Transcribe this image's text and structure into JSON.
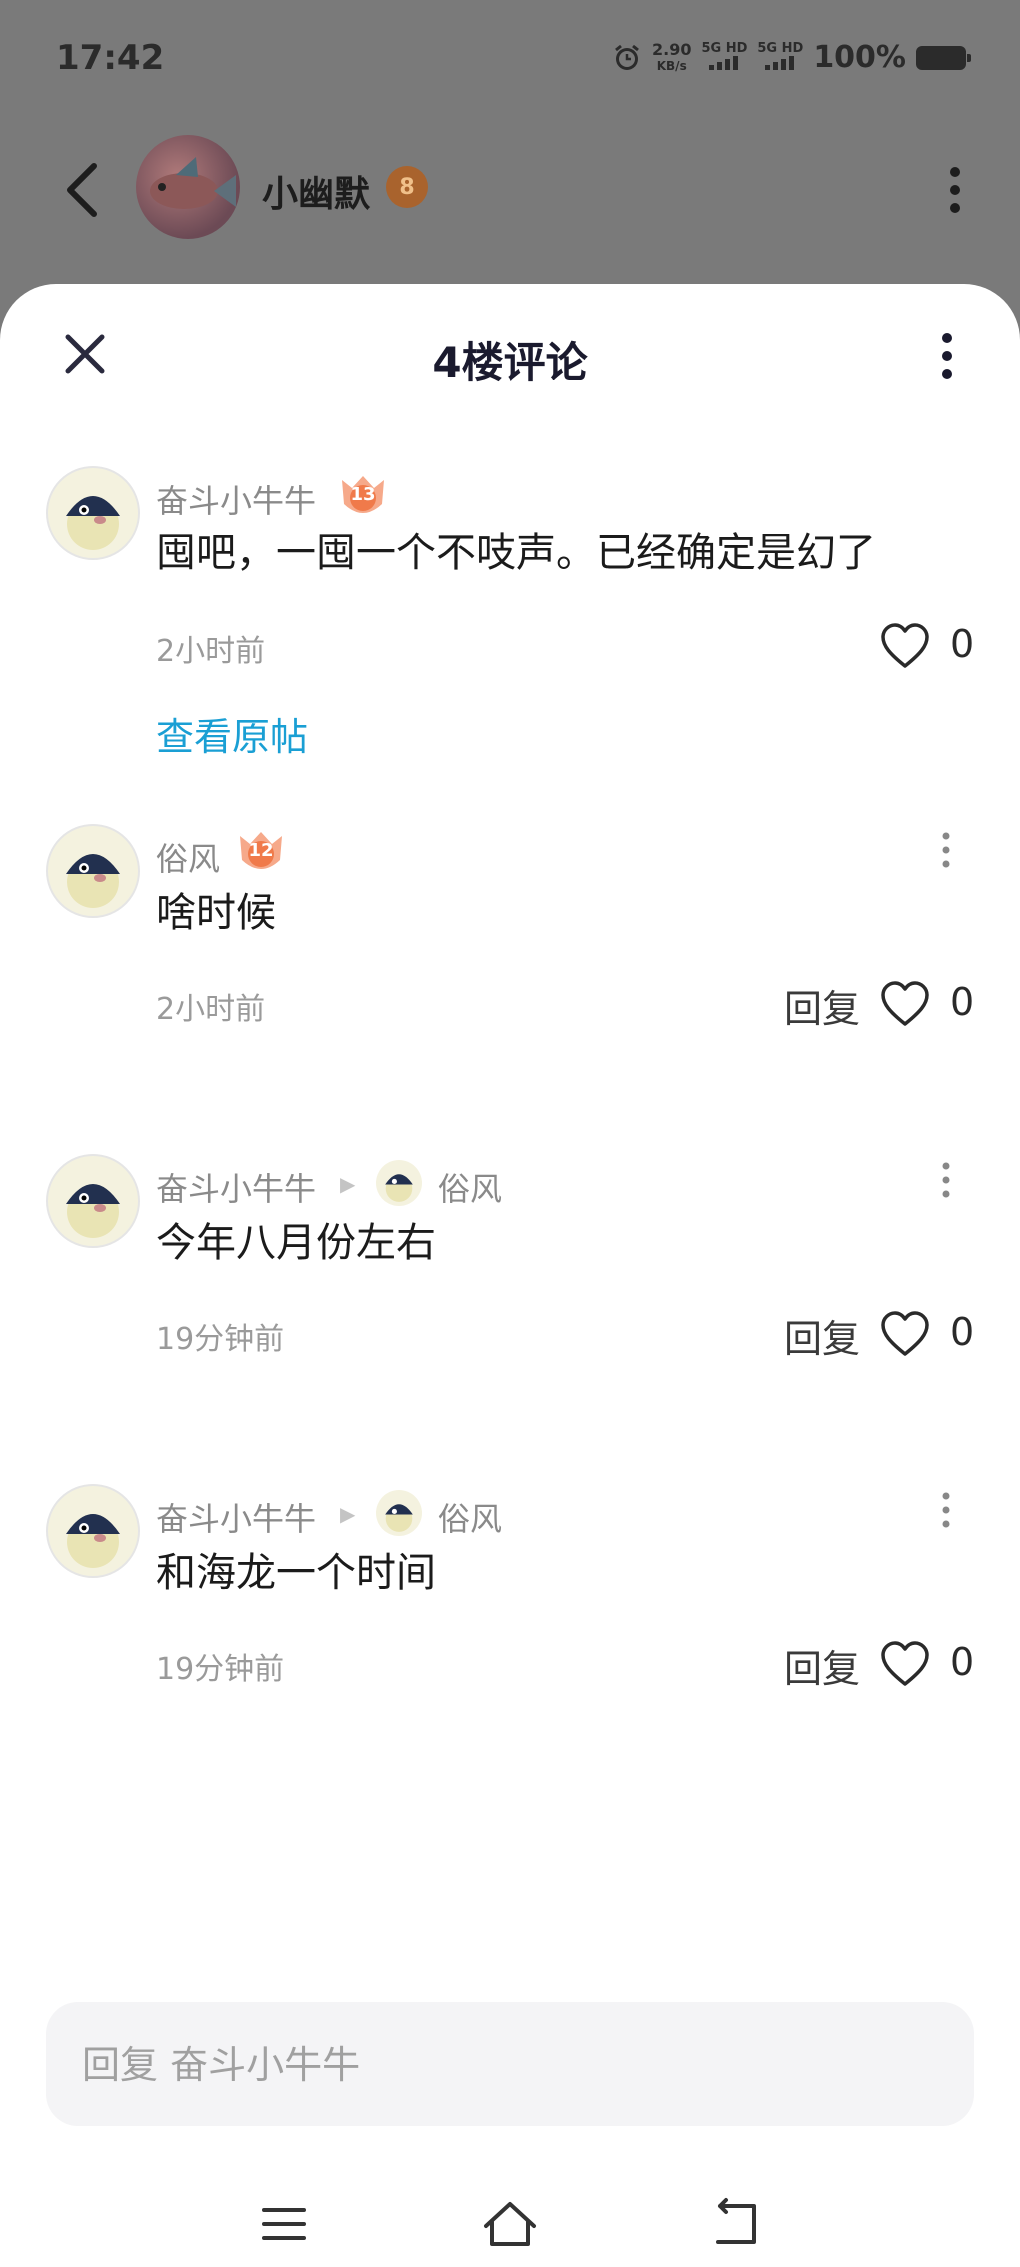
{
  "status_bar": {
    "time": "17:42",
    "net_speed_value": "2.90",
    "net_speed_unit": "KB/s",
    "signal_1": "5G HD",
    "signal_2": "5G HD",
    "battery": "100%"
  },
  "topbar": {
    "username": "小幽默",
    "badge_level": "8"
  },
  "sheet": {
    "title": "4楼评论"
  },
  "comments": [
    {
      "user": "奋斗小牛牛",
      "level": "13",
      "text": "囤吧，一囤一个不吱声。已经确定是幻了",
      "time": "2小时前",
      "likes": "0",
      "view_post_label": "查看原帖"
    },
    {
      "user": "俗风",
      "level": "12",
      "text": "啥时候",
      "time": "2小时前",
      "reply_label": "回复",
      "likes": "0"
    },
    {
      "user": "奋斗小牛牛",
      "reply_to": "俗风",
      "text": "今年八月份左右",
      "time": "19分钟前",
      "reply_label": "回复",
      "likes": "0"
    },
    {
      "user": "奋斗小牛牛",
      "reply_to": "俗风",
      "text": "和海龙一个时间",
      "time": "19分钟前",
      "reply_label": "回复",
      "likes": "0"
    }
  ],
  "reply_input": {
    "placeholder": "回复 奋斗小牛牛"
  },
  "icons": {
    "back": "back-arrow-icon",
    "more": "more-vertical-icon",
    "close": "close-icon",
    "like": "heart-icon",
    "nav_menu": "menu-icon",
    "nav_home": "home-icon",
    "nav_back": "back-icon"
  },
  "colors": {
    "link": "#1a9fd4",
    "badge_orange": "#f07a4a",
    "sheet_bg": "#ffffff",
    "dim_bg": "#7a7a7a"
  }
}
